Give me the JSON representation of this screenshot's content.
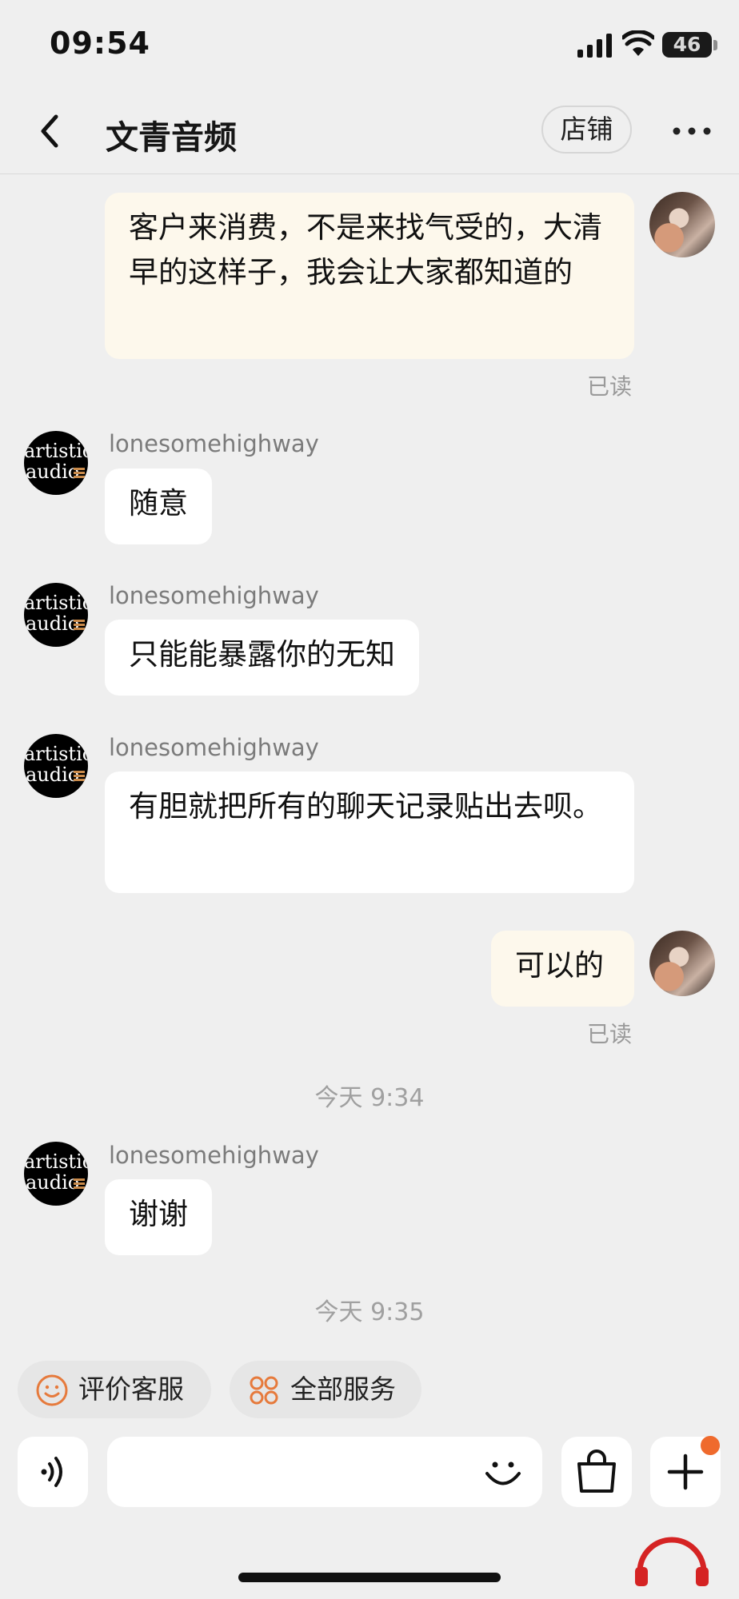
{
  "status_bar": {
    "time": "09:54",
    "battery": "46"
  },
  "nav": {
    "title": "文青音频",
    "shop_button": "店铺"
  },
  "messages": [
    {
      "from": "self",
      "text": "客户来消费，不是来找气受的，大清早的这样子，我会让大家都知道的",
      "read": "已读"
    },
    {
      "from": "shop",
      "sender": "lonesomehighway",
      "text": "随意"
    },
    {
      "from": "shop",
      "sender": "lonesomehighway",
      "text": "只能能暴露你的无知"
    },
    {
      "from": "shop",
      "sender": "lonesomehighway",
      "text": "有胆就把所有的聊天记录贴出去呗。"
    },
    {
      "from": "self",
      "text": "可以的",
      "read": "已读"
    },
    {
      "timestamp": "今天 9:34"
    },
    {
      "from": "shop",
      "sender": "lonesomehighway",
      "text": "谢谢"
    },
    {
      "timestamp": "今天 9:35"
    }
  ],
  "shop_avatar": {
    "line1": "artistic",
    "line2": "audio"
  },
  "quick_actions": {
    "rate_service": "评价客服",
    "all_services": "全部服务"
  },
  "input": {
    "placeholder": "",
    "value": ""
  },
  "colors": {
    "self_bubble": "#fdf8ec",
    "other_bubble": "#ffffff",
    "accent": "#ef6a2d",
    "background": "#efefef"
  },
  "icons": [
    "back-icon",
    "more-icon",
    "voice-icon",
    "emoji-icon",
    "shopping-bag-icon",
    "plus-icon",
    "smile-icon",
    "services-grid-icon"
  ]
}
